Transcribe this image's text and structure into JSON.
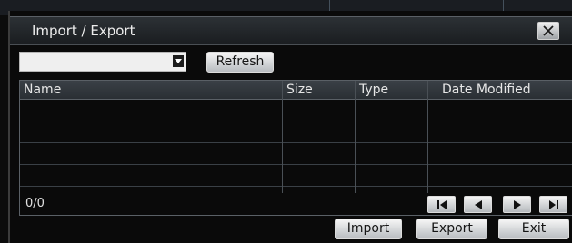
{
  "dialog": {
    "title": "Import / Export",
    "close_icon": "close-x-icon"
  },
  "toolbar": {
    "dropdown_value": "",
    "refresh_label": "Refresh"
  },
  "table": {
    "columns": [
      "Name",
      "Size",
      "Type",
      "Date Modified"
    ],
    "rows": [
      [
        "",
        "",
        "",
        ""
      ],
      [
        "",
        "",
        "",
        ""
      ],
      [
        "",
        "",
        "",
        ""
      ],
      [
        "",
        "",
        "",
        ""
      ]
    ]
  },
  "pagination": {
    "counter": "0/0",
    "icons": [
      "first-page-icon",
      "prev-page-icon",
      "next-page-icon",
      "last-page-icon"
    ]
  },
  "actions": {
    "import_label": "Import",
    "export_label": "Export",
    "exit_label": "Exit"
  }
}
